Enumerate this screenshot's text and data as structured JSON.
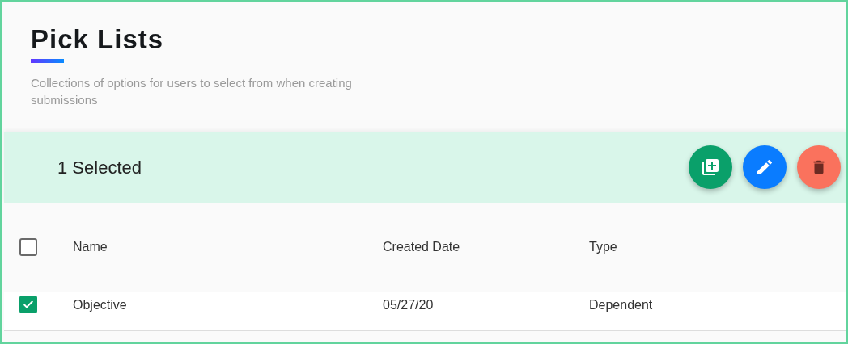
{
  "page": {
    "title": "Pick Lists",
    "subtitle": "Collections of options for users to select from when creating submissions"
  },
  "selection_bar": {
    "label": "1 Selected",
    "actions": [
      {
        "kind": "add"
      },
      {
        "kind": "edit"
      },
      {
        "kind": "delete"
      }
    ]
  },
  "table": {
    "select_all": {
      "checked": false
    },
    "columns": [
      "Name",
      "Created Date",
      "Type"
    ],
    "rows": [
      {
        "selected": true,
        "cells": [
          "Objective",
          "05/27/20",
          "Dependent"
        ]
      }
    ]
  }
}
